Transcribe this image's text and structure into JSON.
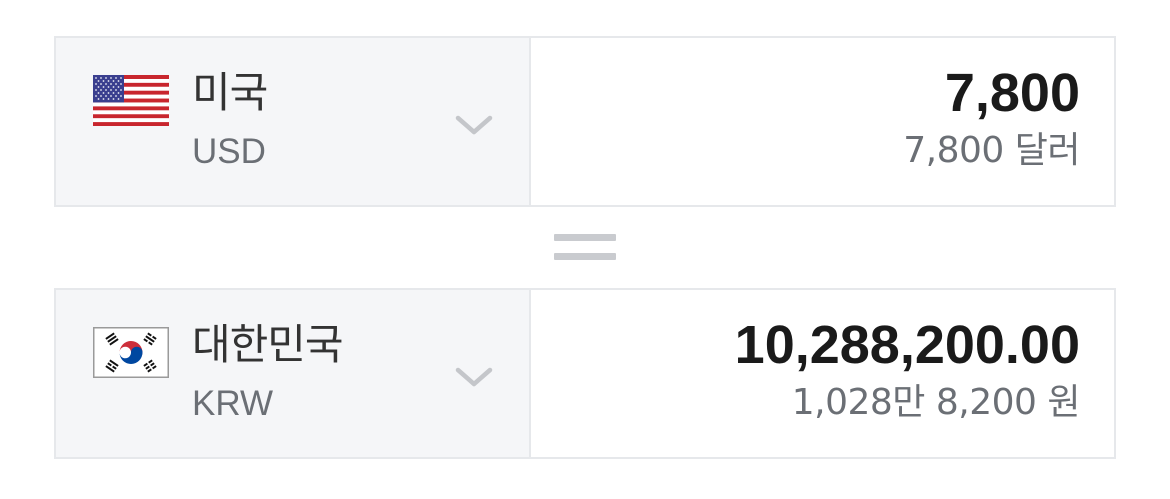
{
  "from": {
    "country": "미국",
    "code": "USD",
    "amount": "7,800",
    "amount_words": "7,800 달러",
    "flag_icon": "us-flag-icon"
  },
  "to": {
    "country": "대한민국",
    "code": "KRW",
    "amount": "10,288,200.00",
    "amount_words": "1,028만 8,200 원",
    "flag_icon": "kr-flag-icon"
  },
  "equals_icon": "equals-icon",
  "dropdown_icon": "chevron-down-icon",
  "colors": {
    "panel_bg": "#f5f6f8",
    "border": "#e6e8eb",
    "amount_text": "#1a1a1a",
    "secondary_text": "#6b6f75",
    "chevron": "#c4c6ca"
  }
}
